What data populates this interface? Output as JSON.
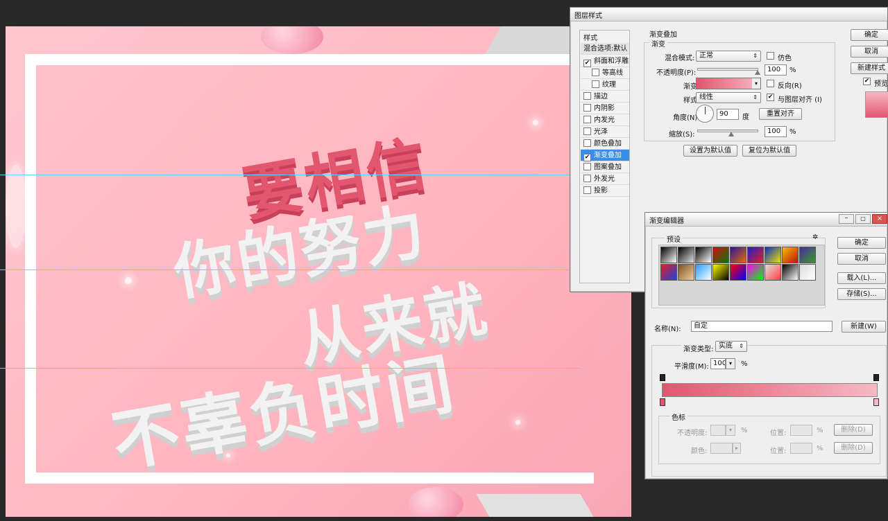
{
  "canvas": {
    "headline1": "要相信",
    "headline2": "你的努力",
    "headline3": "从来就",
    "headline4": "不辜负时间",
    "accent_color": "#e2566e",
    "text_light_color": "#f2f2f2"
  },
  "layer_style": {
    "title": "图层样式",
    "styles_header": "样式",
    "blend_options": "混合选项:默认",
    "items": [
      {
        "label": "斜面和浮雕",
        "checked": "✔"
      },
      {
        "label": "等高线",
        "checked": ""
      },
      {
        "label": "纹理",
        "checked": ""
      },
      {
        "label": "描边",
        "checked": ""
      },
      {
        "label": "内阴影",
        "checked": ""
      },
      {
        "label": "内发光",
        "checked": ""
      },
      {
        "label": "光泽",
        "checked": ""
      },
      {
        "label": "颜色叠加",
        "checked": ""
      },
      {
        "label": "渐变叠加",
        "checked": "✔"
      },
      {
        "label": "图案叠加",
        "checked": ""
      },
      {
        "label": "外发光",
        "checked": ""
      },
      {
        "label": "投影",
        "checked": ""
      }
    ],
    "section_title": "渐变叠加",
    "group_title": "渐变",
    "blend_mode_label": "混合模式:",
    "blend_mode_value": "正常",
    "dither_label": "仿色",
    "opacity_label": "不透明度(P):",
    "opacity_value": "100",
    "percent": "%",
    "gradient_label": "渐变:",
    "reverse_label": "反向(R)",
    "style_label": "样式:",
    "style_value": "线性",
    "align_label": "与图层对齐 (I)",
    "angle_label": "角度(N):",
    "angle_value": "90",
    "degree": "度",
    "reset_align": "重置对齐",
    "scale_label": "缩放(S):",
    "scale_value": "100",
    "set_default": "设置为默认值",
    "reset_default": "复位为默认值",
    "ok": "确定",
    "cancel": "取消",
    "new_style": "新建样式",
    "preview": "预览"
  },
  "gradient_editor": {
    "title": "渐变编辑器",
    "presets_label": "预设",
    "gear_icon": "✲",
    "ok": "确定",
    "cancel": "取消",
    "load": "载入(L)...",
    "save": "存储(S)...",
    "name_label": "名称(N):",
    "name_value": "自定",
    "new_button": "新建(W)",
    "type_label": "渐变类型:",
    "type_value": "实底",
    "smooth_label": "平滑度(M):",
    "smooth_value": "100",
    "percent": "%",
    "stops_title": "色标",
    "stop_opacity_label": "不透明度:",
    "position_label": "位置:",
    "delete_label": "删除(D)",
    "color_label": "颜色:",
    "gradient_start": "#e2566e",
    "gradient_end": "#f7b9c4",
    "presets": [
      {
        "from": "#000000",
        "to": "#ffffff"
      },
      {
        "from": "#000000",
        "to": "#e0e0e0"
      },
      {
        "from": "#000000",
        "to": "#ffffff"
      },
      {
        "from": "#d01010",
        "to": "#0a7a0a"
      },
      {
        "from": "#3010a0",
        "to": "#e07000"
      },
      {
        "from": "#2020d0",
        "to": "#e02020"
      },
      {
        "from": "#0a30c0",
        "to": "#f0e000"
      },
      {
        "from": "#f0c000",
        "to": "#c01010"
      },
      {
        "from": "#4a2aa0",
        "to": "#3a9a2a"
      },
      {
        "from": "#e02020",
        "to": "#2040e0"
      },
      {
        "from": "#805020",
        "to": "#f0d0a0"
      },
      {
        "from": "#20a0ff",
        "to": "#ffffff"
      },
      {
        "from": "#ffff00",
        "to": "#000000"
      },
      {
        "from": "#ff0000",
        "to": "#0000ff"
      },
      {
        "from": "#ff00ff",
        "to": "#00ff00"
      },
      {
        "from": "#e0e0e0",
        "to": "#ff4040"
      },
      {
        "from": "#000000",
        "to": "#ffffff"
      },
      {
        "from": "#dddddd",
        "to": "#ffffff"
      }
    ]
  }
}
